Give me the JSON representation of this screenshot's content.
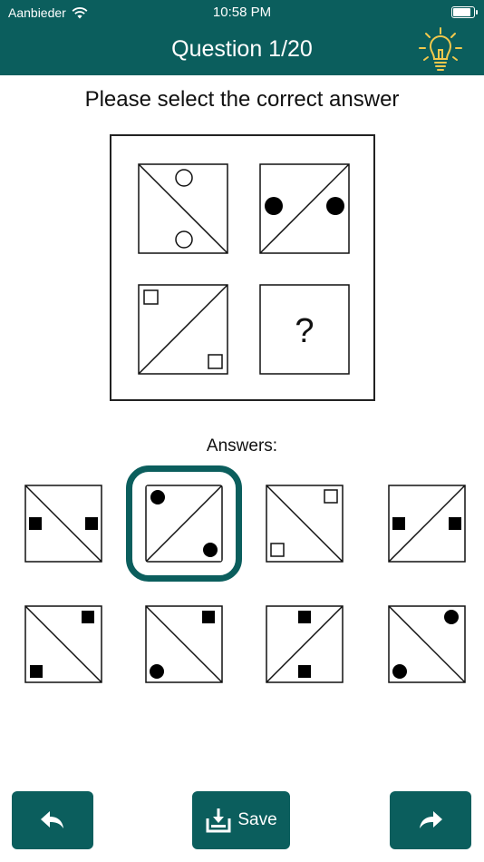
{
  "status_bar": {
    "carrier": "Aanbieder",
    "time": "10:58 PM",
    "battery_level": 0.95
  },
  "header": {
    "title": "Question 1/20",
    "hint_icon": "lightbulb-icon"
  },
  "prompt": "Please select the correct answer",
  "puzzle": {
    "question_mark": "?"
  },
  "answers": {
    "label": "Answers:",
    "selected_index": 1,
    "count": 8
  },
  "footer": {
    "back_icon": "reply-arrow-icon",
    "save_label": "Save",
    "save_icon": "download-tray-icon",
    "forward_icon": "forward-arrow-icon"
  },
  "colors": {
    "primary": "#0b5e5d",
    "bulb": "#f2c94c"
  }
}
